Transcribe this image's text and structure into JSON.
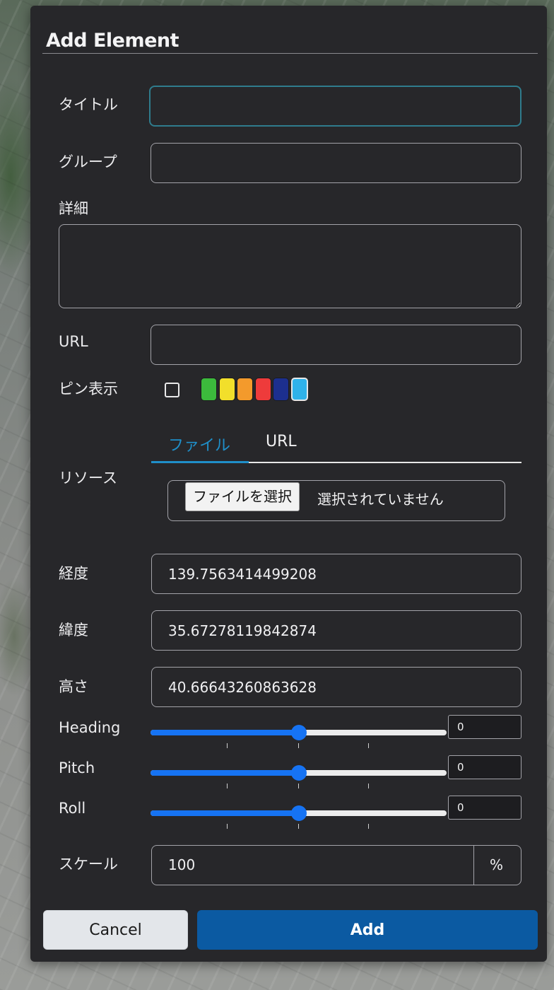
{
  "dialog": {
    "title": "Add Element"
  },
  "form": {
    "title_label": "タイトル",
    "title_value": "",
    "group_label": "グループ",
    "group_value": "",
    "detail_label": "詳細",
    "detail_value": "",
    "url_label": "URL",
    "url_value": "",
    "pin_label": "ピン表示",
    "pin_checked": false,
    "pin_colors": [
      "#3cba3c",
      "#f2df2b",
      "#f39a2c",
      "#ee3b3b",
      "#1c2f8e",
      "#2fb2ea"
    ],
    "pin_selected_color": "#2fb2ea",
    "resource_label": "リソース",
    "resource_tabs": [
      {
        "label": "ファイル",
        "active": true
      },
      {
        "label": "URL",
        "active": false
      }
    ],
    "file_button_label": "ファイルを選択",
    "file_status": "選択されていません",
    "longitude_label": "経度",
    "longitude_value": "139.7563414499208",
    "latitude_label": "緯度",
    "latitude_value": "35.67278119842874",
    "height_label": "高さ",
    "height_value": "40.66643260863628",
    "heading_label": "Heading",
    "heading_value": "0",
    "pitch_label": "Pitch",
    "pitch_value": "0",
    "roll_label": "Roll",
    "roll_value": "0",
    "slider_fraction": 0.5,
    "scale_label": "スケール",
    "scale_value": "100",
    "scale_unit": "%"
  },
  "actions": {
    "cancel_label": "Cancel",
    "add_label": "Add"
  },
  "colors": {
    "accent": "#1f8fc9",
    "slider": "#1673f3",
    "primary_button": "#0b5aa2"
  }
}
